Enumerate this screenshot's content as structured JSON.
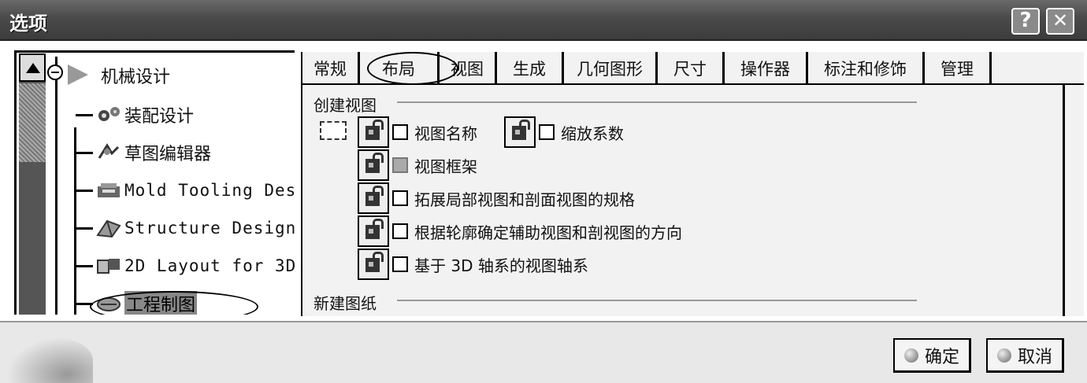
{
  "window": {
    "title": "选项",
    "help_label": "?",
    "close_label": "✕"
  },
  "tree": {
    "root": "机械设计",
    "items": [
      {
        "label": "装配设计",
        "icon": "gears-icon"
      },
      {
        "label": "草图编辑器",
        "icon": "sketcher-icon"
      },
      {
        "label": "Mold Tooling Des",
        "icon": "mold-icon"
      },
      {
        "label": "Structure Design",
        "icon": "structure-icon"
      },
      {
        "label": "2D Layout for 3D",
        "icon": "layout-icon"
      },
      {
        "label": "工程制图",
        "icon": "drafting-icon"
      }
    ]
  },
  "tabs": [
    "常规",
    "布局",
    "视图",
    "生成",
    "几何图形",
    "尺寸",
    "操作器",
    "标注和修饰",
    "管理"
  ],
  "active_tab": "布局",
  "groups": {
    "create_view": {
      "title": "创建视图",
      "options": [
        {
          "label": "视图名称",
          "checked": false
        },
        {
          "label": "缩放系数",
          "checked": false
        },
        {
          "label": "视图框架",
          "checked": true
        },
        {
          "label": "拓展局部视图和剖面视图的规格",
          "checked": false
        },
        {
          "label": "根据轮廓确定辅助视图和剖视图的方向",
          "checked": false
        },
        {
          "label": "基于 3D 轴系的视图轴系",
          "checked": false
        }
      ]
    },
    "new_sheet": {
      "title": "新建图纸"
    }
  },
  "buttons": {
    "ok": "确定",
    "cancel": "取消"
  }
}
